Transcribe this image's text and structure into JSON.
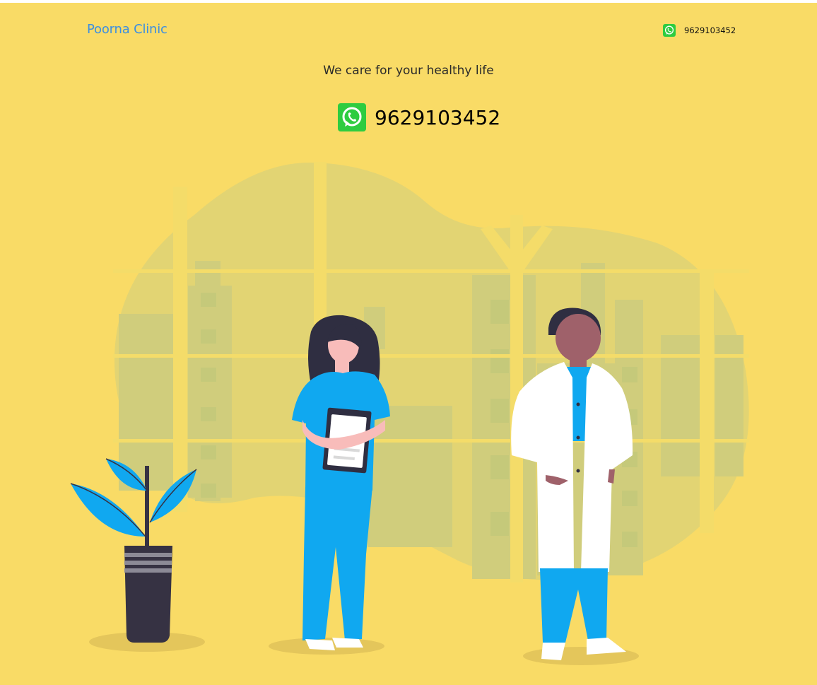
{
  "brand": {
    "name": "Poorna Clinic",
    "color": "#3d8fe0"
  },
  "header": {
    "phone": "9629103452",
    "phone_icon": "whatsapp-icon"
  },
  "hero": {
    "tagline": "We care for your healthy life",
    "phone": "9629103452",
    "phone_icon": "whatsapp-icon"
  },
  "illustration": {
    "name": "doctors-illustration",
    "subjects": [
      "nurse",
      "doctor",
      "potted-plant"
    ]
  },
  "colors": {
    "background": "#f9db66",
    "whatsapp": "#2ecc40",
    "scrubs": "#10a8f0",
    "pot": "#363243"
  }
}
